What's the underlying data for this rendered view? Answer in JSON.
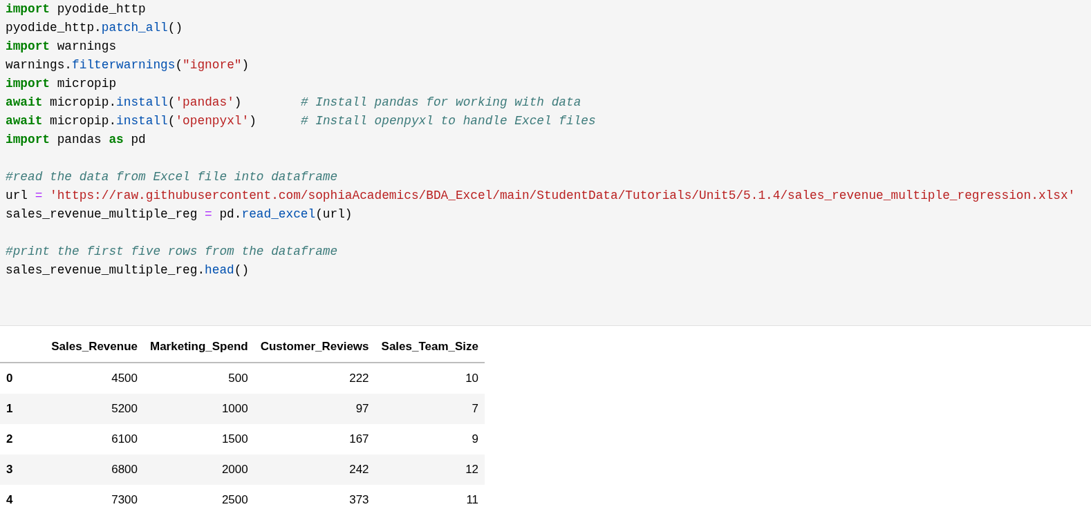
{
  "code_cell": {
    "blocks": [
      [
        {
          "tokens": [
            {
              "kind": "keyword",
              "text": "import"
            },
            {
              "kind": "plain",
              "text": " pyodide_http"
            }
          ]
        },
        {
          "tokens": [
            {
              "kind": "plain",
              "text": "pyodide_http."
            },
            {
              "kind": "function",
              "text": "patch_all"
            },
            {
              "kind": "plain",
              "text": "()"
            }
          ]
        },
        {
          "tokens": [
            {
              "kind": "keyword",
              "text": "import"
            },
            {
              "kind": "plain",
              "text": " warnings"
            }
          ]
        },
        {
          "tokens": [
            {
              "kind": "plain",
              "text": "warnings."
            },
            {
              "kind": "function",
              "text": "filterwarnings"
            },
            {
              "kind": "plain",
              "text": "("
            },
            {
              "kind": "string",
              "text": "\"ignore\""
            },
            {
              "kind": "plain",
              "text": ")"
            }
          ]
        },
        {
          "tokens": [
            {
              "kind": "keyword",
              "text": "import"
            },
            {
              "kind": "plain",
              "text": " micropip"
            }
          ]
        },
        {
          "tokens": [
            {
              "kind": "keyword",
              "text": "await"
            },
            {
              "kind": "plain",
              "text": " micropip."
            },
            {
              "kind": "function",
              "text": "install"
            },
            {
              "kind": "plain",
              "text": "("
            },
            {
              "kind": "string",
              "text": "'pandas'"
            },
            {
              "kind": "plain",
              "text": ")        "
            },
            {
              "kind": "comment",
              "text": "# Install pandas for working with data"
            }
          ]
        },
        {
          "tokens": [
            {
              "kind": "keyword",
              "text": "await"
            },
            {
              "kind": "plain",
              "text": " micropip."
            },
            {
              "kind": "function",
              "text": "install"
            },
            {
              "kind": "plain",
              "text": "("
            },
            {
              "kind": "string",
              "text": "'openpyxl'"
            },
            {
              "kind": "plain",
              "text": ")      "
            },
            {
              "kind": "comment",
              "text": "# Install openpyxl to handle Excel files"
            }
          ]
        },
        {
          "tokens": [
            {
              "kind": "keyword",
              "text": "import"
            },
            {
              "kind": "plain",
              "text": " pandas "
            },
            {
              "kind": "keyword",
              "text": "as"
            },
            {
              "kind": "plain",
              "text": " pd"
            }
          ]
        }
      ],
      [
        {
          "tokens": [
            {
              "kind": "comment",
              "text": "#read the data from Excel file into dataframe"
            }
          ]
        },
        {
          "tokens": [
            {
              "kind": "plain",
              "text": "url "
            },
            {
              "kind": "operator",
              "text": "="
            },
            {
              "kind": "string",
              "text": " 'https://raw.githubusercontent.com/sophiaAcademics/BDA_Excel/main/StudentData/Tutorials/Unit5/5.1.4/sales_revenue_multiple_regression.xlsx'"
            }
          ]
        },
        {
          "tokens": [
            {
              "kind": "plain",
              "text": "sales_revenue_multiple_reg "
            },
            {
              "kind": "operator",
              "text": "="
            },
            {
              "kind": "plain",
              "text": " pd."
            },
            {
              "kind": "function",
              "text": "read_excel"
            },
            {
              "kind": "plain",
              "text": "(url)"
            }
          ]
        }
      ],
      [
        {
          "tokens": [
            {
              "kind": "comment",
              "text": "#print the first five rows from the dataframe"
            }
          ]
        },
        {
          "tokens": [
            {
              "kind": "plain",
              "text": "sales_revenue_multiple_reg."
            },
            {
              "kind": "function",
              "text": "head"
            },
            {
              "kind": "plain",
              "text": "()"
            }
          ]
        }
      ]
    ]
  },
  "output_table": {
    "columns": [
      "Sales_Revenue",
      "Marketing_Spend",
      "Customer_Reviews",
      "Sales_Team_Size"
    ],
    "rows": [
      {
        "index": "0",
        "cells": [
          "4500",
          "500",
          "222",
          "10"
        ]
      },
      {
        "index": "1",
        "cells": [
          "5200",
          "1000",
          "97",
          "7"
        ]
      },
      {
        "index": "2",
        "cells": [
          "6100",
          "1500",
          "167",
          "9"
        ]
      },
      {
        "index": "3",
        "cells": [
          "6800",
          "2000",
          "242",
          "12"
        ]
      },
      {
        "index": "4",
        "cells": [
          "7300",
          "2500",
          "373",
          "11"
        ]
      }
    ]
  }
}
